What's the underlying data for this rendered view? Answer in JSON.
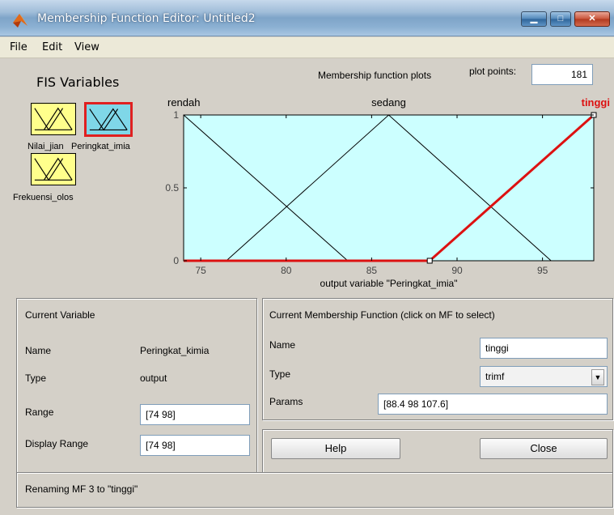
{
  "window": {
    "title": "Membership Function Editor: Untitled2",
    "minimize_glyph": "▁",
    "maximize_glyph": "□",
    "close_glyph": "✕",
    "icon": "matlab-icon"
  },
  "menu": {
    "items": [
      "File",
      "Edit",
      "View"
    ]
  },
  "fis_variables": {
    "heading": "FIS Variables",
    "variables": [
      {
        "label": "Nilai_jian",
        "role": "input",
        "color": "#ffff8c"
      },
      {
        "label": "Peringkat_imia",
        "role": "output",
        "color": "#7fd7e8",
        "selected": true
      },
      {
        "label": "Frekuensi_olos",
        "role": "input",
        "color": "#ffff8c"
      }
    ]
  },
  "plot": {
    "title": "Membership function plots",
    "plot_points_label": "plot points:",
    "plot_points_value": "181",
    "xlabel": "output variable \"Peringkat_imia\""
  },
  "chart_data": {
    "type": "line",
    "xlim": [
      74,
      98
    ],
    "ylim": [
      0,
      1
    ],
    "xticks": [
      75,
      80,
      85,
      90,
      95
    ],
    "yticks": [
      0,
      0.5,
      1
    ],
    "xtick_labels": [
      "75",
      "80",
      "85",
      "90",
      "95"
    ],
    "ytick_labels": [
      "0",
      "0.5",
      "1"
    ],
    "grid": false,
    "series": [
      {
        "name": "rendah",
        "points": [
          [
            74,
            1
          ],
          [
            83.6,
            0
          ]
        ],
        "selected": false
      },
      {
        "name": "sedang",
        "points": [
          [
            76.5,
            0
          ],
          [
            86,
            1
          ],
          [
            95.5,
            0
          ]
        ],
        "selected": false
      },
      {
        "name": "tinggi",
        "points": [
          [
            88.4,
            0
          ],
          [
            98,
            1
          ]
        ],
        "selected": true
      }
    ],
    "selected_color": "#dd1111",
    "background": "#ccffff"
  },
  "current_variable": {
    "heading": "Current Variable",
    "name_label": "Name",
    "name_value": "Peringkat_kimia",
    "type_label": "Type",
    "type_value": "output",
    "range_label": "Range",
    "range_value": "[74 98]",
    "display_range_label": "Display Range",
    "display_range_value": "[74 98]"
  },
  "current_mf": {
    "heading": "Current Membership Function (click on MF to select)",
    "name_label": "Name",
    "name_value": "tinggi",
    "type_label": "Type",
    "type_value": "trimf",
    "params_label": "Params",
    "params_value": "[88.4 98 107.6]"
  },
  "buttons": {
    "help": "Help",
    "close": "Close"
  },
  "status": {
    "text": "Renaming MF 3 to \"tinggi\""
  }
}
